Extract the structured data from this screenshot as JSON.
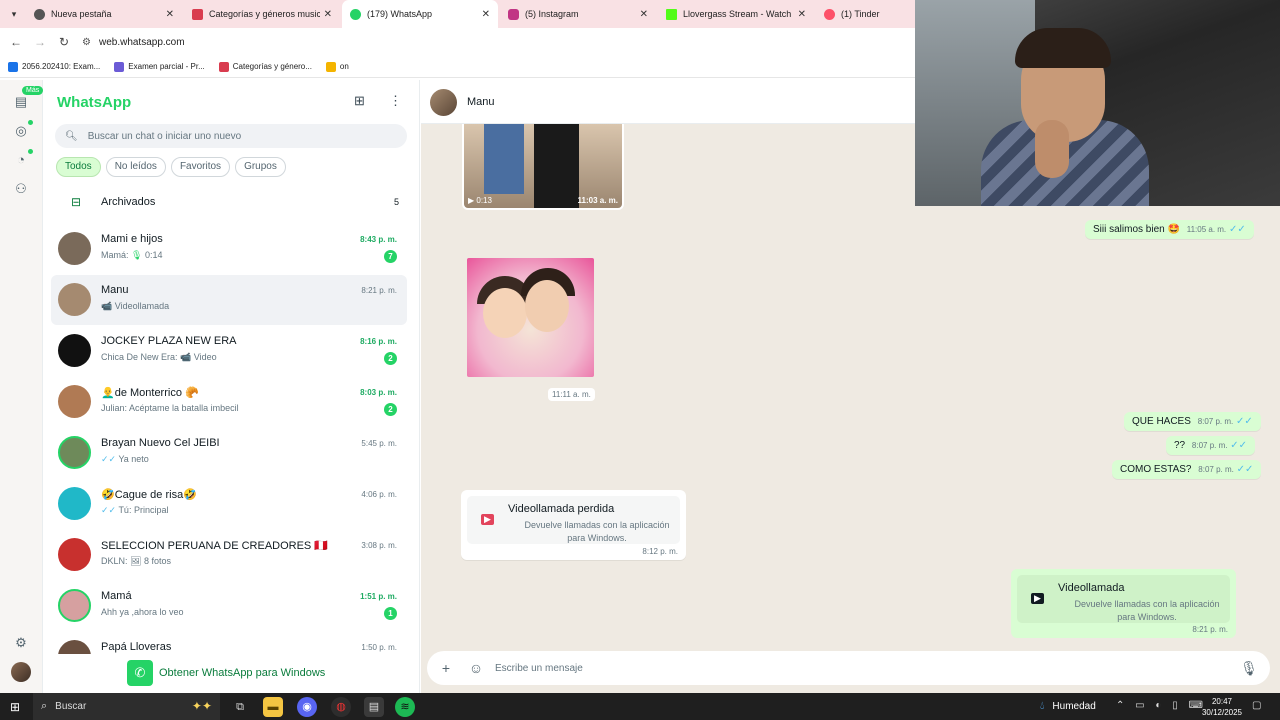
{
  "browser": {
    "tabs": [
      {
        "title": "Nueva pestaña",
        "active": false,
        "favicon_color": "#555555"
      },
      {
        "title": "Categorías y géneros musicales",
        "active": false,
        "favicon_color": "#d93c4f"
      },
      {
        "title": "(179) WhatsApp",
        "active": true,
        "favicon_color": "#25d366"
      },
      {
        "title": "(5) Instagram",
        "active": false,
        "favicon_color": "#c13584"
      },
      {
        "title": "Llovergass Stream - Watch Live",
        "active": false,
        "favicon_color": "#53fc18"
      },
      {
        "title": "(1) Tinder",
        "active": false,
        "favicon_color": "#fd5068"
      }
    ],
    "url": "web.whatsapp.com",
    "bookmarks": [
      {
        "label": "2056.202410: Exam...",
        "favicon_color": "#1a73e8"
      },
      {
        "label": "Examen parcial - Pr...",
        "favicon_color": "#6b5bd6"
      },
      {
        "label": "Categorías y género...",
        "favicon_color": "#d93c4f"
      },
      {
        "label": "on",
        "favicon_color": "#f4b400"
      }
    ]
  },
  "rail": {
    "more_badge": "Más",
    "icons": [
      "chats-icon",
      "status-icon",
      "channels-icon",
      "communities-icon",
      "settings-icon"
    ]
  },
  "chatlist": {
    "title": "WhatsApp",
    "search_placeholder": "Buscar un chat o iniciar uno nuevo",
    "filters": [
      "Todos",
      "No leídos",
      "Favoritos",
      "Grupos"
    ],
    "archived_label": "Archivados",
    "archived_count": "5",
    "chats": [
      {
        "name": "Mami e hijos",
        "time": "8:43 p. m.",
        "unread": "7",
        "prefix": "Mamá: ",
        "icon": "🎙",
        "preview": "0:14",
        "avatar": "#7a6a5a"
      },
      {
        "name": "Manu",
        "time": "8:21 p. m.",
        "unread": "",
        "prefix": "",
        "icon": "📹",
        "preview": "Videollamada",
        "avatar": "#a58a70",
        "selected": true
      },
      {
        "name": "JOCKEY PLAZA NEW ERA",
        "time": "8:16 p. m.",
        "unread": "2",
        "prefix": "Chica De New Era: ",
        "icon": "📹",
        "preview": "Video",
        "avatar": "#111111"
      },
      {
        "name": "👨‍🦲de Monterrico 🥐",
        "time": "8:03 p. m.",
        "unread": "2",
        "prefix": "",
        "icon": "",
        "preview": "Julian: Acéptame la batalla imbecil",
        "avatar": "#b07a54"
      },
      {
        "name": "Brayan Nuevo Cel JEIBI",
        "time": "5:45 p. m.",
        "unread": "",
        "prefix": "",
        "icon": "✓✓",
        "preview": "Ya neto",
        "avatar": "#6e8a5a"
      },
      {
        "name": "🤣Cague de risa🤣",
        "time": "4:06 p. m.",
        "unread": "",
        "prefix": "",
        "icon": "✓✓",
        "preview": "Tú: Principal",
        "avatar": "#20b8c8"
      },
      {
        "name": "SELECCION PERUANA DE CREADORES 🇵🇪",
        "time": "3:08 p. m.",
        "unread": "",
        "prefix": "DKLN: ",
        "icon": "🖼",
        "preview": "8 fotos",
        "avatar": "#c8302e"
      },
      {
        "name": "Mamá",
        "time": "1:51 p. m.",
        "unread": "1",
        "prefix": "",
        "icon": "",
        "preview": "Ahh ya ,ahora lo veo",
        "avatar": "#d6a0a0"
      },
      {
        "name": "Papá Lloveras",
        "time": "1:50 p. m.",
        "unread": "",
        "prefix": "",
        "icon": "",
        "preview": "",
        "avatar": "#6a5040"
      }
    ],
    "get_windows": "Obtener WhatsApp para Windows"
  },
  "conversation": {
    "contact_name": "Manu",
    "video": {
      "duration": "0:13",
      "time": "11:03 a. m."
    },
    "messages_out": [
      {
        "text": "Siii salimos bien 🤩",
        "time": "11:05 a. m."
      },
      {
        "text": "QUE HACES",
        "time": "8:07 p. m."
      },
      {
        "text": "??",
        "time": "8:07 p. m."
      },
      {
        "text": "COMO ESTAS?",
        "time": "8:07 p. m."
      }
    ],
    "sticker_time": "11:11 a. m.",
    "missed_call": {
      "title": "Videollamada perdida",
      "subtitle": "Devuelve llamadas con la aplicación para Windows.",
      "time": "8:12 p. m."
    },
    "video_call": {
      "title": "Videollamada",
      "subtitle": "Devuelve llamadas con la aplicación para Windows.",
      "time": "8:21 p. m."
    },
    "composer_placeholder": "Escribe un mensaje"
  },
  "taskbar": {
    "search_label": "Buscar",
    "weather": "Humedad",
    "time": "20:47",
    "date": "30/12/2025"
  },
  "colors": {
    "accent": "#25d366",
    "outgoing_bubble": "#d9fdd3",
    "chat_bg": "#efeae2"
  }
}
